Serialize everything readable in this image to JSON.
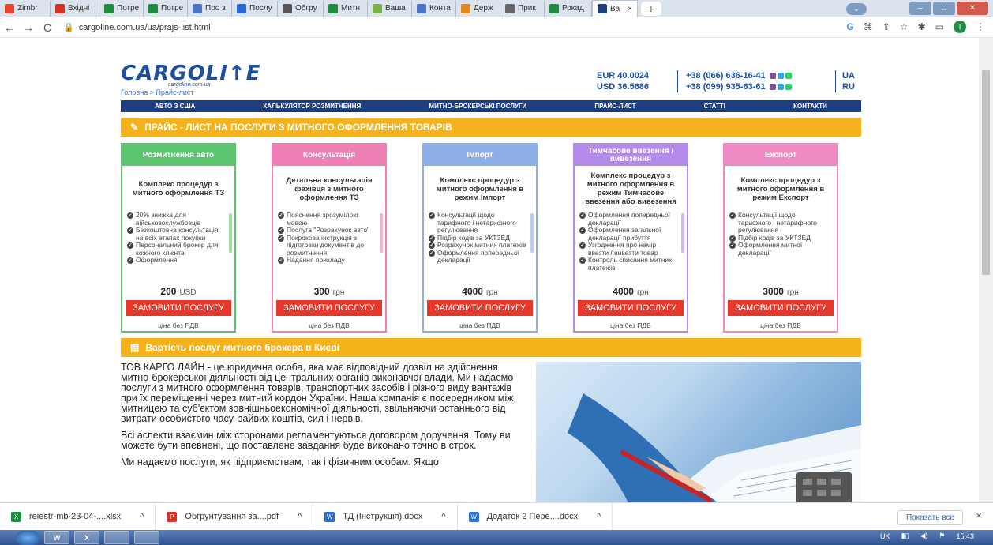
{
  "browser": {
    "tabs": [
      {
        "label": "Zimbr",
        "color": "#e8472b"
      },
      {
        "label": "Вхідні",
        "color": "#d93025"
      },
      {
        "label": "Потре",
        "color": "#1e8e3e"
      },
      {
        "label": "Потре",
        "color": "#1e8e3e"
      },
      {
        "label": "Про з",
        "color": "#4a76c7"
      },
      {
        "label": "Послу",
        "color": "#2a6bd1"
      },
      {
        "label": "Обгру",
        "color": "#555555"
      },
      {
        "label": "Митн",
        "color": "#1e8e3e"
      },
      {
        "label": "Ваша",
        "color": "#7cb342"
      },
      {
        "label": "Конта",
        "color": "#4a76c7"
      },
      {
        "label": "Держ",
        "color": "#e08a1e"
      },
      {
        "label": "Прик",
        "color": "#666666"
      },
      {
        "label": "Рокад",
        "color": "#1e8e3e"
      },
      {
        "label": "Ва",
        "color": "#1b3f80",
        "active": true
      }
    ],
    "new_tab": "+",
    "tab_close": "×",
    "url": "cargoline.com.ua/ua/prajs-list.html",
    "profile_initial": "T"
  },
  "site": {
    "logo": "CARGOLI↑E",
    "logo_sub": "cargoline.com.ua",
    "breadcrumb": "Головна > Прайс-лист",
    "rates": [
      "EUR 40.0024",
      "USD 36.5686"
    ],
    "phones": [
      "+38 (066) 636-16-41",
      "+38 (099) 935-63-61"
    ],
    "langs": [
      "UA",
      "RU"
    ],
    "menu": [
      "АВТО З США",
      "КАЛЬКУЛЯТОР РОЗМИТНЕННЯ",
      "МИТНО-БРОКЕРСЬКІ ПОСЛУГИ",
      "ПРАЙС-ЛИСТ",
      "СТАТТІ",
      "КОНТАКТИ"
    ],
    "price_header": "ПРАЙС - ЛИСТ НА ПОСЛУГИ З МИТНОГО ОФОРМЛЕННЯ ТОВАРІВ",
    "broker_header": "Вартість послуг митного брокера в Києві"
  },
  "cards": [
    {
      "head": "Розмитнення авто",
      "color": "#5cc46f",
      "title": "Комплекс процедур з митного оформлення ТЗ",
      "items": [
        "20% знижка для військовослужбовців",
        "Безкоштовна консультація на всіх етапах покупки",
        "Персональний брокер для кожного клієнта",
        "Оформлення"
      ],
      "price": "200",
      "currency": "USD",
      "button": "ЗАМОВИТИ ПОСЛУГУ",
      "note": "ціна без ПДВ"
    },
    {
      "head": "Консультація",
      "color": "#ef7fb4",
      "title": "Детальна консультація фахівця з митного оформлення ТЗ",
      "items": [
        "Пояснення зрозумілою мовою",
        "Послуга \"Розрахунок авто\"",
        "Покрокова інструкція з підготовки документів до розмитнення",
        "Надання прикладу"
      ],
      "price": "300",
      "currency": "грн",
      "button": "ЗАМОВИТИ ПОСЛУГУ",
      "note": "ціна без ПДВ"
    },
    {
      "head": "Імпорт",
      "color": "#8eaee8",
      "title": "Комплекс процедур з митного оформлення в режим Імпорт",
      "items": [
        "Консультації щодо тарифного і нетарифного регулювання",
        "Підбір кодів за УКТЗЕД",
        "Розрахунок митних платежів",
        "Оформлення попередньої декларації"
      ],
      "price": "4000",
      "currency": "грн",
      "button": "ЗАМОВИТИ ПОСЛУГУ",
      "note": "ціна без ПДВ"
    },
    {
      "head": "Тимчасове ввезення / вивезення",
      "color": "#b48ae8",
      "title": "Комплекс процедур з митного оформлення в режим Тимчасове ввезення або вивезення",
      "items": [
        "Оформлення попередньої декларації",
        "Оформлення загальної декларації прибуття",
        "Узгодження про намір ввезти / вивезти товар",
        "Контроль списання митних платежів"
      ],
      "price": "4000",
      "currency": "грн",
      "button": "ЗАМОВИТИ ПОСЛУГУ",
      "note": "ціна без ПДВ"
    },
    {
      "head": "Експорт",
      "color": "#f08ac4",
      "title": "Комплекс процедур з митного оформлення в режим Експорт",
      "items": [
        "Консультації щодо тарифного і нетарифного регулювання",
        "Підбір кодів за УКТЗЕД",
        "Оформлення митної декларації"
      ],
      "price": "3000",
      "currency": "грн",
      "button": "ЗАМОВИТИ ПОСЛУГУ",
      "note": "ціна без ПДВ"
    }
  ],
  "content": {
    "p1": "ТОВ КАРГО ЛАЙН - це юридична особа, яка має відповідний дозвіл на здійснення митно-брокерської діяльності від центральних органів виконавчої влади. Ми надаємо послуги з митного оформлення товарів, транспортних засобів і різного виду вантажів при їх переміщенні через митний кордон України. Наша компанія є посередником між митницею та суб'єктом зовнішньоекономічної діяльності, звільняючи останнього від витрати особистого часу, зайвих коштів, сил і нервів.",
    "p2": "Всі аспекти взаємин між сторонами регламентуються договором доручення. Тому ви можете бути впевнені, що поставлене завдання буде виконано точно в строк.",
    "p3": "Ми надаємо послуги, як підприємствам, так і фізичним особам. Якщо"
  },
  "downloads": {
    "items": [
      {
        "name": "reiestr-mb-23-04-....xlsx",
        "color": "#1e8e3e",
        "glyph": "X"
      },
      {
        "name": "Обгрунтування за....pdf",
        "color": "#d93025",
        "glyph": "P"
      },
      {
        "name": "ТД (Інструкція).docx",
        "color": "#2a6bd1",
        "glyph": "W"
      },
      {
        "name": "Додаток 2 Пере....docx",
        "color": "#2a6bd1",
        "glyph": "W"
      }
    ],
    "show_all": "Показать все",
    "close": "×"
  },
  "taskbar": {
    "apps": [
      "W",
      "X",
      "",
      ""
    ],
    "lang": "UK",
    "time": "15:43"
  }
}
